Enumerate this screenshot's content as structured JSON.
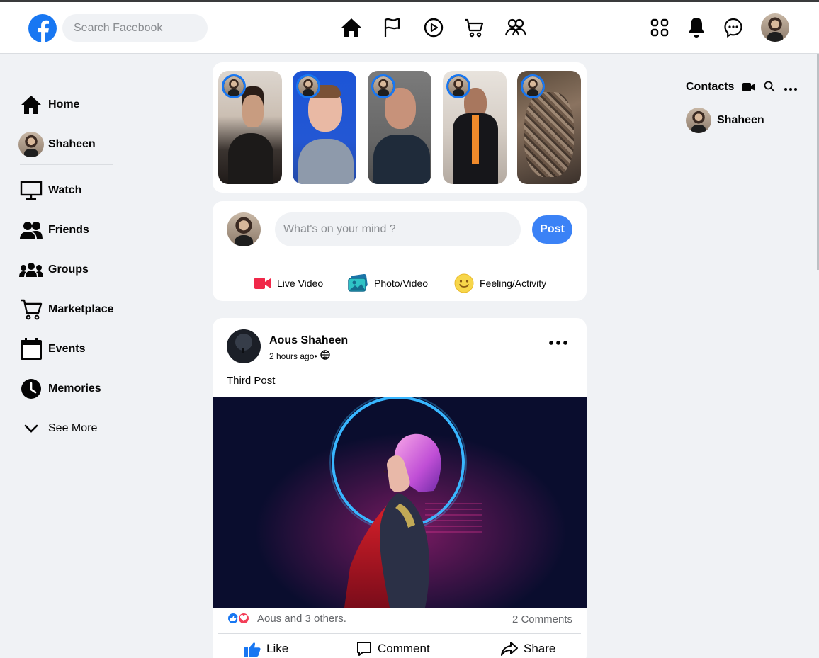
{
  "header": {
    "search_placeholder": "Search Facebook",
    "nav": [
      "home-icon",
      "flag-icon",
      "watch-icon",
      "marketplace-icon",
      "groups-icon"
    ],
    "right": [
      "menu-grid-icon",
      "notifications-icon",
      "messenger-icon"
    ]
  },
  "sidebar": {
    "items": [
      {
        "label": "Home",
        "icon": "home-icon"
      },
      {
        "label": "Shaheen",
        "icon": "avatar"
      },
      {
        "label": "Watch",
        "icon": "monitor-icon"
      },
      {
        "label": "Friends",
        "icon": "friends-icon"
      },
      {
        "label": "Groups",
        "icon": "groups-icon"
      },
      {
        "label": "Marketplace",
        "icon": "cart-icon"
      },
      {
        "label": "Events",
        "icon": "calendar-icon"
      },
      {
        "label": "Memories",
        "icon": "clock-icon"
      },
      {
        "label": "See More",
        "icon": "chevron-down-icon"
      }
    ]
  },
  "stories": {
    "count": 5
  },
  "composer": {
    "placeholder": "What's on your mind ?",
    "post_label": "Post",
    "actions": [
      {
        "label": "Live Video",
        "color": "#f02849"
      },
      {
        "label": "Photo/Video",
        "color": "#45bd62"
      },
      {
        "label": "Feeling/Activity",
        "color": "#f7b928"
      }
    ]
  },
  "post": {
    "author": "Aous Shaheen",
    "time": "2 hours ago•",
    "text": "Third Post",
    "reactions_text": "Aous and 3 others.",
    "comments": "2 Comments",
    "actions": [
      "Like",
      "Comment",
      "Share"
    ]
  },
  "contacts": {
    "title": "Contacts",
    "items": [
      {
        "name": "Shaheen"
      }
    ]
  },
  "colors": {
    "brand": "#1877f2",
    "post_button": "#3b82f6",
    "background": "#f0f2f5"
  }
}
